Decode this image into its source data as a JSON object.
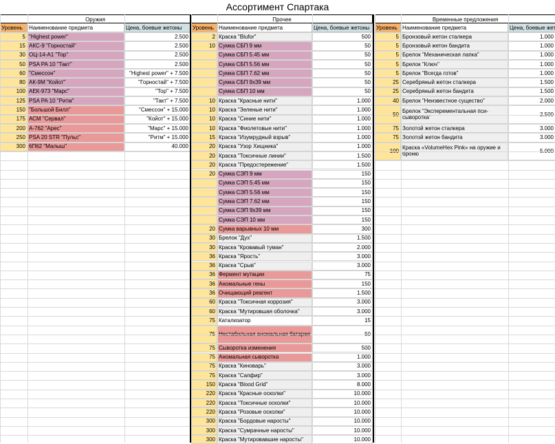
{
  "title": "Ассортимент Спартака",
  "colors": {
    "level": "#ffe599",
    "level_header": "#f6b26b",
    "price_header": "#d0e0e3",
    "purple": "#d5a6bd",
    "red": "#ea9999",
    "grey": "#efefef",
    "white": "#ffffff"
  },
  "weapons": {
    "title": "Оружия",
    "headers": {
      "level": "Уровень",
      "name": "Наименование предмета",
      "price": "Цена, боевые жетоны"
    },
    "rows": [
      {
        "level": "5",
        "name": "\"Highest power\"",
        "price": "2.500",
        "color": "purple"
      },
      {
        "level": "15",
        "name": "АКС-9 \"Горностай\"",
        "price": "2.500",
        "color": "purple"
      },
      {
        "level": "30",
        "name": "ОЦ-14-А1 \"Тор\"",
        "price": "2.500",
        "color": "purple"
      },
      {
        "level": "50",
        "name": "PSA PA 10 \"Такт\"",
        "price": "2.500",
        "color": "purple"
      },
      {
        "level": "60",
        "name": "\"Смессон\"",
        "price": "\"Highest power\" + 7.500",
        "color": "purple"
      },
      {
        "level": "80",
        "name": "АК-9М \"Койот\"",
        "price": "\"Горностай\" + 7.500",
        "color": "purple"
      },
      {
        "level": "100",
        "name": "АЕК-973 \"Марс\"",
        "price": "\"Тор\" + 7.500",
        "color": "purple"
      },
      {
        "level": "125",
        "name": "PSA PA 10 \"Ритм\"",
        "price": "\"Такт\" + 7.500",
        "color": "purple"
      },
      {
        "level": "150",
        "name": "\"Большой Билл\"",
        "price": "\"Смессон\" + 15.000",
        "color": "red"
      },
      {
        "level": "175",
        "name": "АСМ \"Сервал\"",
        "price": "\"Койот\" + 15.000",
        "color": "red"
      },
      {
        "level": "200",
        "name": "А-762 \"Арес\"",
        "price": "\"Марс\" + 15.000",
        "color": "red"
      },
      {
        "level": "250",
        "name": "PSA 20 STR \"Пульс\"",
        "price": "\"Ритм\" + 15.000",
        "color": "red"
      },
      {
        "level": "300",
        "name": "6П62 \"Малыш\"",
        "price": "40.000",
        "color": "red"
      }
    ]
  },
  "other": {
    "title": "Прочее",
    "headers": {
      "level": "Уровень",
      "name": "Наименование предмета",
      "price": "Цена, боевые жетоны"
    },
    "rows": [
      {
        "level": "2",
        "name": "Краска \"Blufor\"",
        "price": "500",
        "color": "grey",
        "span": 1
      },
      {
        "level": "10",
        "name": "Сумка СБП 9 мм",
        "price": "50",
        "color": "purple",
        "span": 1
      },
      {
        "level": "",
        "name": "Сумка СБП 5.45 мм",
        "price": "50",
        "color": "purple",
        "span": 1
      },
      {
        "level": "",
        "name": "Сумка СБП 5.56 мм",
        "price": "50",
        "color": "purple",
        "span": 1
      },
      {
        "level": "",
        "name": "Сумка СБП 7.62 мм",
        "price": "50",
        "color": "purple",
        "span": 1
      },
      {
        "level": "",
        "name": "Сумка СБП 9х39 мм",
        "price": "50",
        "color": "purple",
        "span": 1
      },
      {
        "level": "",
        "name": "Сумка СБП 10 мм",
        "price": "50",
        "color": "purple",
        "span": 1
      },
      {
        "level": "10",
        "name": "Краска \"Красные нити\"",
        "price": "1.000",
        "color": "grey",
        "span": 1
      },
      {
        "level": "10",
        "name": "Краска \"Зеленые нити\"",
        "price": "1.000",
        "color": "grey",
        "span": 1
      },
      {
        "level": "10",
        "name": "Краска \"Синие нити\"",
        "price": "1.000",
        "color": "grey",
        "span": 1
      },
      {
        "level": "10",
        "name": "Краска \"Фиолетовые нити\"",
        "price": "1.000",
        "color": "grey",
        "span": 1
      },
      {
        "level": "15",
        "name": "Краска \"Изумрудный взрыв\"",
        "price": "1.000",
        "color": "grey",
        "span": 1
      },
      {
        "level": "20",
        "name": "Краска \"Узор Хищника\"",
        "price": "1.000",
        "color": "grey",
        "span": 1
      },
      {
        "level": "20",
        "name": "Краска \"Токсичные линии\"",
        "price": "1.500",
        "color": "grey",
        "span": 1
      },
      {
        "level": "20",
        "name": "Краска \"Предостережение\"",
        "price": "1.500",
        "color": "grey",
        "span": 1
      },
      {
        "level": "20",
        "name": "Сумка СЭП 9 мм",
        "price": "150",
        "color": "purple",
        "span": 1
      },
      {
        "level": "",
        "name": "Сумка СЭП 5.45 мм",
        "price": "150",
        "color": "purple",
        "span": 1
      },
      {
        "level": "",
        "name": "Сумка СЭП 5.56 мм",
        "price": "150",
        "color": "purple",
        "span": 1
      },
      {
        "level": "",
        "name": "Сумка СЭП 7.62 мм",
        "price": "150",
        "color": "purple",
        "span": 1
      },
      {
        "level": "",
        "name": "Сумка СЭП 9х39 мм",
        "price": "150",
        "color": "purple",
        "span": 1
      },
      {
        "level": "",
        "name": "Сумка СЭП 10 мм",
        "price": "150",
        "color": "purple",
        "span": 1
      },
      {
        "level": "20",
        "name": "Сумка варывных 10 мм",
        "price": "300",
        "color": "red",
        "span": 1
      },
      {
        "level": "30",
        "name": "Брелок \"Дух\"",
        "price": "1.500",
        "color": "grey",
        "span": 1
      },
      {
        "level": "30",
        "name": "Краска \"Кровавый туман\"",
        "price": "2.000",
        "color": "grey",
        "span": 1
      },
      {
        "level": "36",
        "name": "Краска \"Ярость\"",
        "price": "3.000",
        "color": "grey",
        "span": 1
      },
      {
        "level": "36",
        "name": "Краска \"Срыв\"",
        "price": "3.000",
        "color": "grey",
        "span": 1
      },
      {
        "level": "36",
        "name": "Фермент мутации",
        "price": "75",
        "color": "red",
        "span": 1
      },
      {
        "level": "36",
        "name": "Аномальные гены",
        "price": "150",
        "color": "red",
        "span": 1
      },
      {
        "level": "36",
        "name": "Очищающий реагент",
        "price": "1.500",
        "color": "red",
        "span": 1
      },
      {
        "level": "60",
        "name": "Краска \"Токсичная коррозия\"",
        "price": "3.000",
        "color": "grey",
        "span": 1
      },
      {
        "level": "60",
        "name": "Краска \"Мутировшая оболочка\"",
        "price": "3.000",
        "color": "grey",
        "span": 1
      },
      {
        "level": "75",
        "name": "Катализатор",
        "price": "15",
        "color": "white",
        "span": 1
      },
      {
        "level": "75",
        "name": "Нестабильная аномальная батарея",
        "price": "50",
        "color": "red",
        "span": 2
      },
      {
        "level": "75",
        "name": "Сыворотка изменения",
        "price": "500",
        "color": "red",
        "span": 1
      },
      {
        "level": "75",
        "name": "Аномальная сыворотка",
        "price": "1.000",
        "color": "red",
        "span": 1
      },
      {
        "level": "75",
        "name": "Краска \"Киноварь\"",
        "price": "3.000",
        "color": "grey",
        "span": 1
      },
      {
        "level": "75",
        "name": "Краска \"Сапфир\"",
        "price": "3.000",
        "color": "grey",
        "span": 1
      },
      {
        "level": "150",
        "name": "Краска \"Blood Grid\"",
        "price": "8.000",
        "color": "grey",
        "span": 1
      },
      {
        "level": "220",
        "name": "Краска \"Красные осколки\"",
        "price": "10.000",
        "color": "grey",
        "span": 1
      },
      {
        "level": "220",
        "name": "Краска \"Токсичные осколки\"",
        "price": "10.000",
        "color": "grey",
        "span": 1
      },
      {
        "level": "220",
        "name": "Краска \"Розовые осколки\"",
        "price": "10.000",
        "color": "grey",
        "span": 1
      },
      {
        "level": "300",
        "name": "Краска \"Бордовые наросты\"",
        "price": "10.000",
        "color": "grey",
        "span": 1
      },
      {
        "level": "300",
        "name": "Краска \"Сумрачные наросты\"",
        "price": "10.000",
        "color": "grey",
        "span": 1
      },
      {
        "level": "300",
        "name": "Краска \"Мутировавшие наросты\"",
        "price": "10.000",
        "color": "grey",
        "span": 1
      }
    ]
  },
  "temporary": {
    "title": "Временные предложения",
    "headers": {
      "level": "Уровень",
      "name": "Наименование предмета",
      "price": "Цена, боевые жетоны"
    },
    "rows": [
      {
        "level": "5",
        "name": "Бронзовый жетон сталкера",
        "price": "1.000",
        "color": "grey",
        "span": 1
      },
      {
        "level": "5",
        "name": "Бронзовый жетон бандита",
        "price": "1.000",
        "color": "grey",
        "span": 1
      },
      {
        "level": "5",
        "name": "Брелок \"Механическая лапка\"",
        "price": "1.000",
        "color": "grey",
        "span": 1
      },
      {
        "level": "5",
        "name": "Брелок \"Ключ\"",
        "price": "1.000",
        "color": "grey",
        "span": 1
      },
      {
        "level": "5",
        "name": "Брелок \"Всегда готов\"",
        "price": "1.000",
        "color": "grey",
        "span": 1
      },
      {
        "level": "25",
        "name": "Серебряный жетон сталкера",
        "price": "1.500",
        "color": "grey",
        "span": 1
      },
      {
        "level": "25",
        "name": "Серебряный жетон бандита",
        "price": "1.500",
        "color": "grey",
        "span": 1
      },
      {
        "level": "40",
        "name": "Брелок \"Неизвестное существо\"",
        "price": "2.000",
        "color": "grey",
        "span": 1
      },
      {
        "level": "50",
        "name": "Брелок \"Эксперементальная пси-сыворотка\"",
        "price": "2.500",
        "color": "grey",
        "span": 2
      },
      {
        "level": "75",
        "name": "Золотой жетон сталкера",
        "price": "3.000",
        "color": "grey",
        "span": 1
      },
      {
        "level": "75",
        "name": "Золотой жетон бандита",
        "price": "3.000",
        "color": "grey",
        "span": 1
      },
      {
        "level": "100",
        "name": "Краска «VolumeHex Pink» на оружие и броню",
        "price": "5.000",
        "color": "grey",
        "span": 2
      }
    ]
  }
}
